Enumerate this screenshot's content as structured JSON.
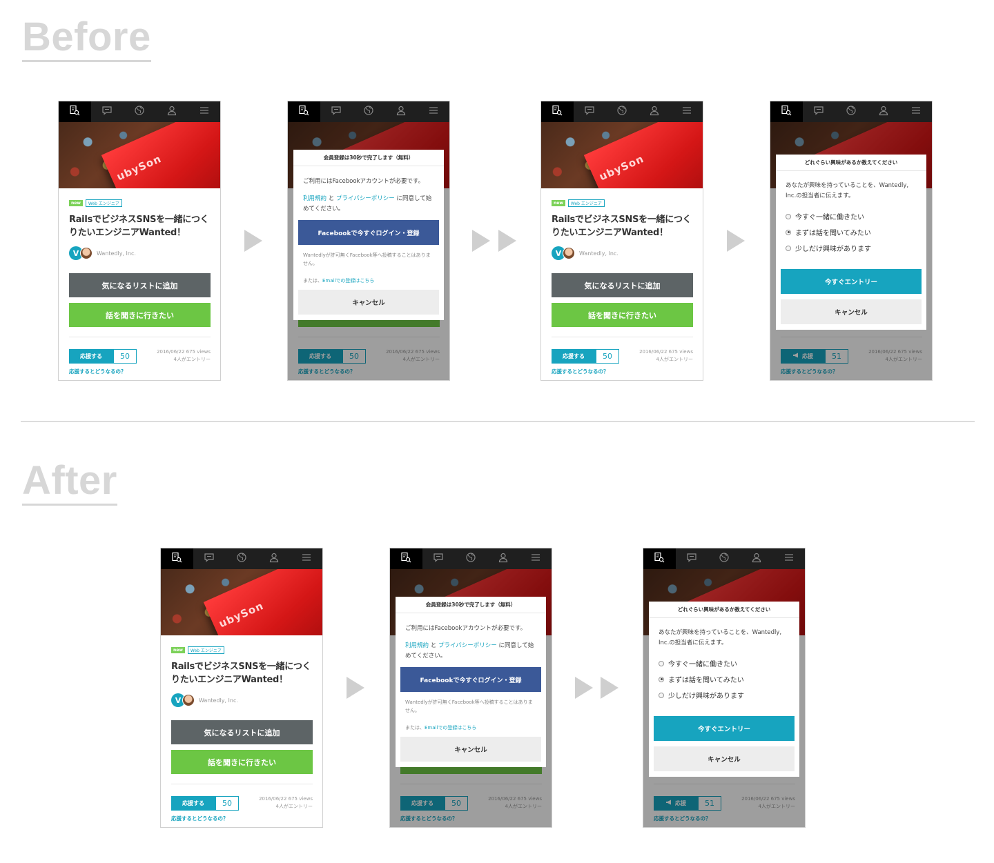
{
  "sections": {
    "before": "Before",
    "after": "After"
  },
  "nav": {
    "icons": [
      "job-search-icon",
      "chat-icon",
      "globe-icon",
      "person-icon",
      "menu-icon"
    ]
  },
  "hero": {
    "book_text": "ubySon"
  },
  "job": {
    "tag_new": "new",
    "tag_category": "Web エンジニア",
    "title": "RailsでビジネスSNSを一緒につくりたいエンジニアWanted！",
    "logo_letter": "V",
    "company": "Wantedly, Inc.",
    "list_button": "気になるリストに追加",
    "talk_button": "話を聞きに行きたい",
    "support_label": "応援する",
    "support_label_after": "応援",
    "support_count": "50",
    "support_count_after": "51",
    "stats_line1": "2016/06/22 675 views",
    "stats_line2": "4人がエントリー",
    "support_link": "応援するとどうなるの？"
  },
  "signup_modal": {
    "header": "会員登録は30秒で完了します（無料）",
    "intro": "ご利用にはFacebookアカウントが必要です。",
    "terms_link": "利用規約",
    "and": "と",
    "privacy_link": "プライバシーポリシー",
    "agree": "に同意して始めてください。",
    "fb_button": "Facebookで今すぐログイン・登録",
    "fb_note": "Wantedlyが許可無くFacebook等へ投稿することはありません。",
    "email_prefix": "または、",
    "email_link": "Emailでの登録はこちら",
    "cancel": "キャンセル"
  },
  "interest_modal": {
    "header": "どれぐらい興味があるか教えてください",
    "intro": "あなたが興味を持っていることを、Wantedly, Inc.の担当者に伝えます。",
    "options": [
      "今すぐ一緒に働きたい",
      "まずは話を聞いてみたい",
      "少しだけ興味があります"
    ],
    "selected_index": 1,
    "entry_button": "今すぐエントリー",
    "cancel": "キャンセル"
  },
  "colors": {
    "accent": "#17a4bf",
    "green": "#6cc644",
    "gray_button": "#5d6466",
    "facebook": "#3b5998"
  }
}
